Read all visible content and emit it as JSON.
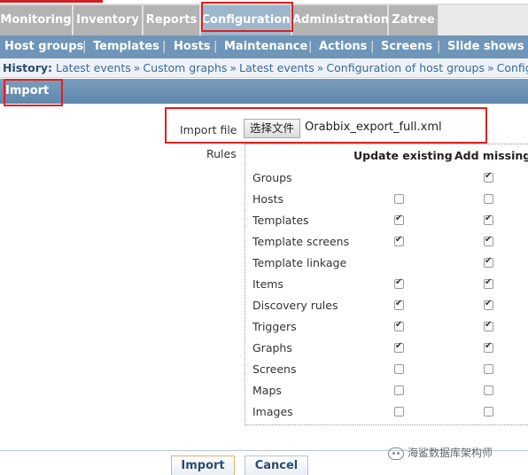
{
  "main_menu": {
    "tabs": [
      {
        "label": "Monitoring"
      },
      {
        "label": "Inventory"
      },
      {
        "label": "Reports"
      },
      {
        "label": "Configuration",
        "active": true
      },
      {
        "label": "Administration"
      },
      {
        "label": "Zatree"
      }
    ]
  },
  "sub_menu": {
    "items": [
      "Host groups",
      "Templates",
      "Hosts",
      "Maintenance",
      "Actions",
      "Screens",
      "Slide shows"
    ],
    "separator": "|"
  },
  "history": {
    "label": "History:",
    "links": [
      "Latest events",
      "Custom graphs",
      "Latest events",
      "Configuration of host groups",
      "Configu"
    ],
    "separator": "»"
  },
  "section": {
    "title": "Import"
  },
  "form": {
    "import_file_label": "Import file",
    "file_button_label": "选择文件",
    "file_name": "Orabbix_export_full.xml",
    "rules_label": "Rules",
    "col_update": "Update existing",
    "col_add": "Add missing",
    "rules": [
      {
        "name": "Groups",
        "update": null,
        "add": true
      },
      {
        "name": "Hosts",
        "update": false,
        "add": false
      },
      {
        "name": "Templates",
        "update": true,
        "add": true
      },
      {
        "name": "Template screens",
        "update": true,
        "add": true
      },
      {
        "name": "Template linkage",
        "update": null,
        "add": true
      },
      {
        "name": "Items",
        "update": true,
        "add": true
      },
      {
        "name": "Discovery rules",
        "update": true,
        "add": true
      },
      {
        "name": "Triggers",
        "update": true,
        "add": true
      },
      {
        "name": "Graphs",
        "update": true,
        "add": true
      },
      {
        "name": "Screens",
        "update": false,
        "add": false
      },
      {
        "name": "Maps",
        "update": false,
        "add": false
      },
      {
        "name": "Images",
        "update": false,
        "add": false
      }
    ]
  },
  "buttons": {
    "import_label": "Import",
    "cancel_label": "Cancel"
  },
  "watermark": {
    "text": "海鲨数据库架构师"
  },
  "colors": {
    "highlight": "#e02020",
    "active_tab": "#9cb6cc",
    "sub_menu": "#6f96b8"
  }
}
